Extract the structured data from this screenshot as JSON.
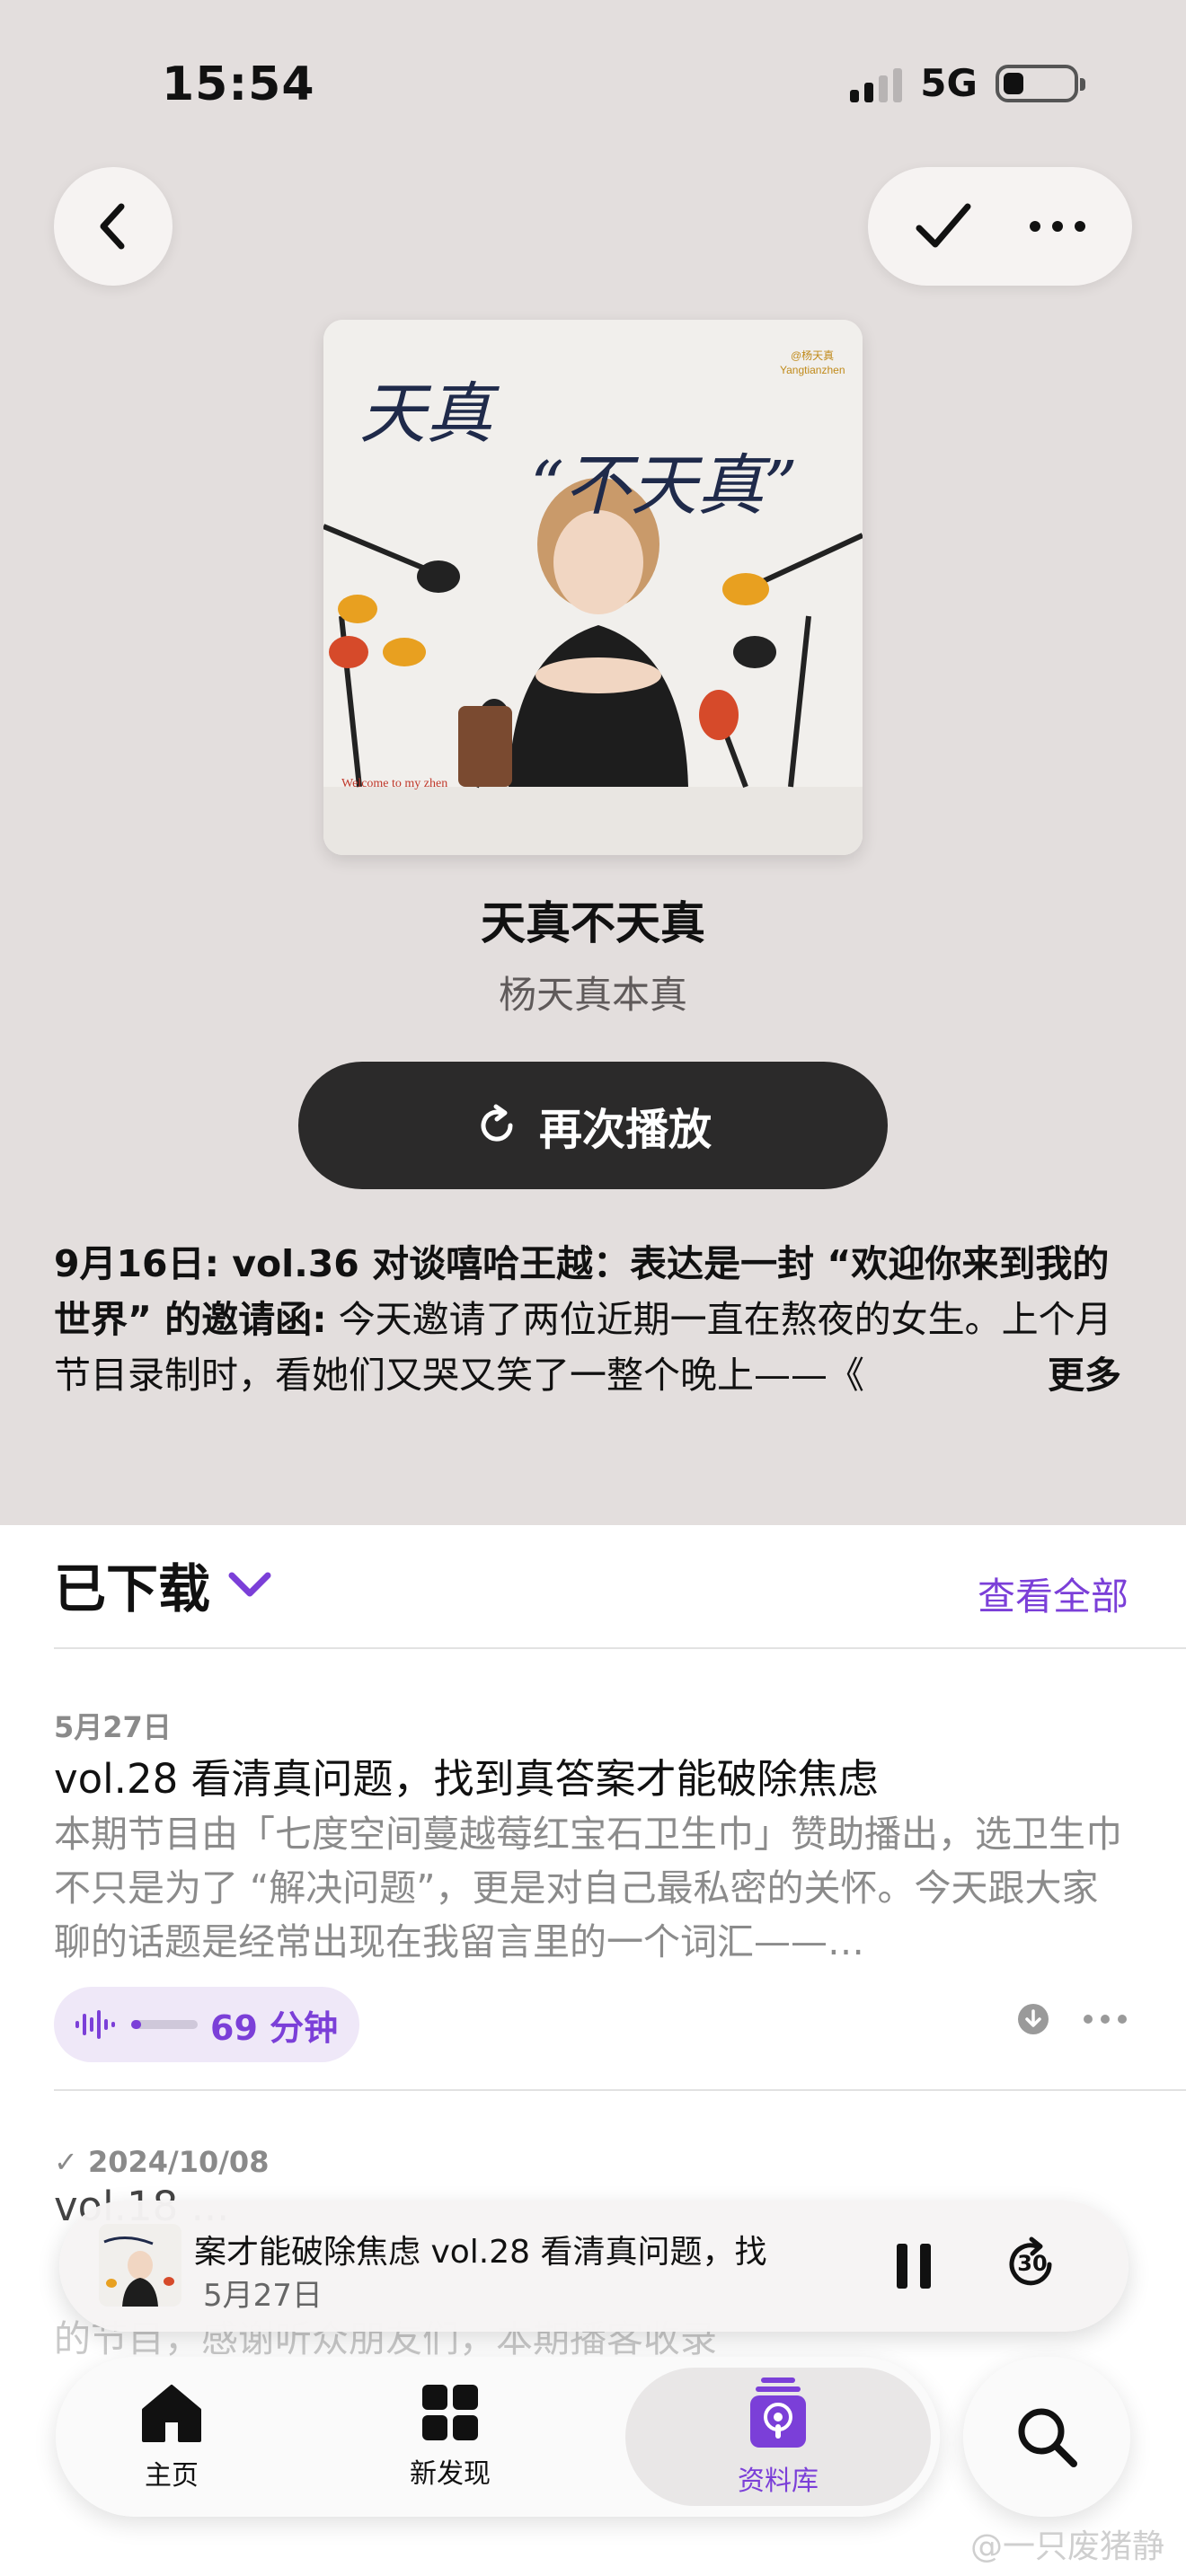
{
  "status": {
    "time": "15:54",
    "network": "5G"
  },
  "show": {
    "title": "天真不天真",
    "author": "杨天真本真",
    "cover_text": {
      "main1": "天真",
      "main2": "“不天真”",
      "handle": "@杨天真",
      "handle_en": "Yangtianzhen",
      "corner": "Welcome to my zhen"
    },
    "replay_label": "再次播放",
    "description_bold": "9月16日: vol.36 对谈嘻哈王越：表达是一封 “欢迎你来到我的世界” 的邀请函:",
    "description_rest": " 今天邀请了两位近期一直在熬夜的女生。上个月节目录制时，看她们又哭又笑了一整个晚上——《",
    "more_label": "更多"
  },
  "downloads": {
    "title": "已下载",
    "see_all": "查看全部",
    "episodes": [
      {
        "date": "5月27日",
        "title": "vol.28 看清真问题，找到真答案才能破除焦虑",
        "desc": "本期节目由「七度空间蔓越莓红宝石卫生巾」赞助播出，选卫生巾不只是为了 “解决问题”，更是对自己最私密的关怀。今天跟大家聊的话题是经常出现在我留言里的一个词汇——…",
        "duration": "69 分钟",
        "progress": 0.15
      },
      {
        "date": "✓ 2024/10/08",
        "title_partial": "vol.18 ...",
        "desc_partial": "的节目，感谢听众朋友们，本期播客收录"
      }
    ]
  },
  "mini_player": {
    "title": "案才能破除焦虑      vol.28 看清真问题，找",
    "date": "5月27日",
    "skip_label": "30"
  },
  "tabs": [
    {
      "label": "主页",
      "icon": "home-icon"
    },
    {
      "label": "新发现",
      "icon": "grid-icon"
    },
    {
      "label": "资料库",
      "icon": "library-podcast-icon",
      "active": true
    }
  ],
  "watermark": "@一只废猪静",
  "colors": {
    "accent": "#7b3fd8",
    "header_bg": "#e3dedd",
    "button_dark": "#2b2a2a"
  }
}
